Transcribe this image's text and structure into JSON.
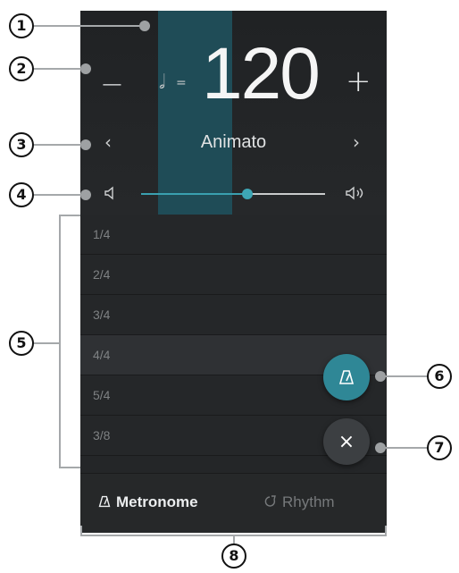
{
  "tempo": {
    "minus": "−",
    "plus": "+",
    "note_symbol": "𝅗𝅥",
    "equals": "=",
    "bpm": "120",
    "name": "Animato",
    "prev": "‹",
    "next": "›"
  },
  "volume": {
    "level": 0.58
  },
  "beats": [
    "1/4",
    "2/4",
    "3/4",
    "4/4",
    "5/4",
    "3/8"
  ],
  "selected_beat_index": 3,
  "tabs": {
    "metronome": "Metronome",
    "rhythm": "Rhythm"
  },
  "close_symbol": "×",
  "callouts": [
    "1",
    "2",
    "3",
    "4",
    "5",
    "6",
    "7",
    "8"
  ],
  "colors": {
    "accent": "#2f8796",
    "panel": "#242628"
  }
}
